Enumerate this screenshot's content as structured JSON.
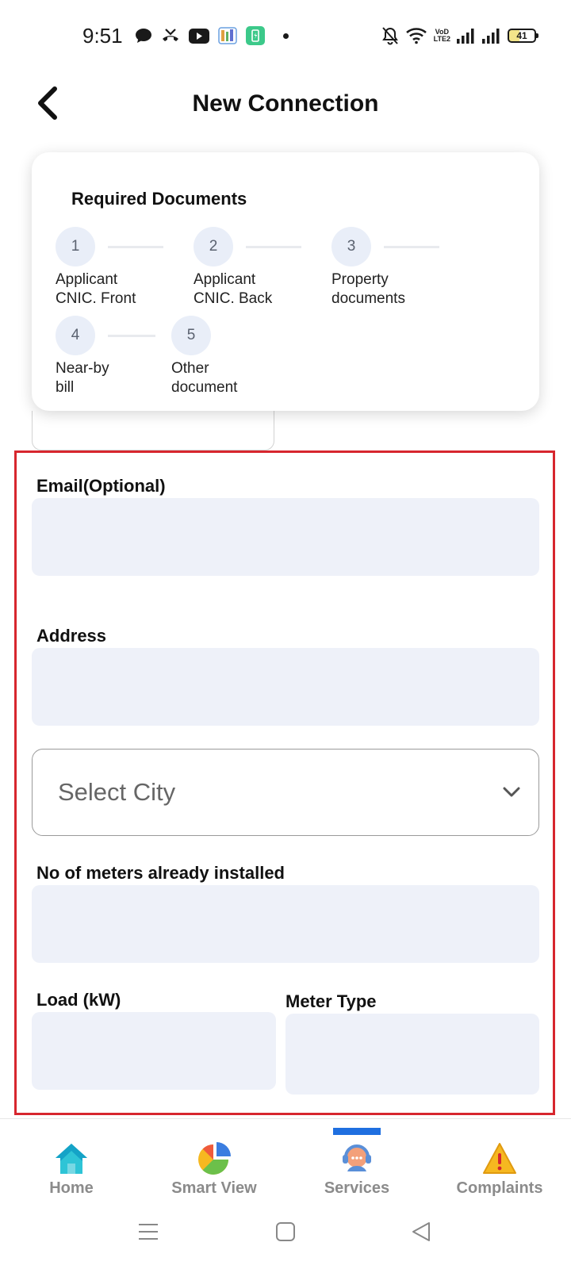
{
  "status_bar": {
    "time": "9:51",
    "battery": "41",
    "icons_left": [
      "chat-bubble-icon",
      "missed-call-icon",
      "youtube-icon",
      "app-icon",
      "battery-saver-icon",
      "dot-icon"
    ],
    "icons_right": [
      "bell-off-icon",
      "wifi-icon",
      "volte-icon",
      "signal-icon",
      "signal-icon",
      "battery-icon"
    ],
    "volte_text": "VoD\nLTE2"
  },
  "header": {
    "title": "New Connection"
  },
  "documents": {
    "title": "Required Documents",
    "steps": [
      {
        "number": "1",
        "label_line1": "Applicant",
        "label_line2": "CNIC. Front"
      },
      {
        "number": "2",
        "label_line1": "Applicant",
        "label_line2": "CNIC. Back"
      },
      {
        "number": "3",
        "label_line1": "Property",
        "label_line2": "documents"
      },
      {
        "number": "4",
        "label_line1": "Near-by",
        "label_line2": "bill"
      },
      {
        "number": "5",
        "label_line1": "Other",
        "label_line2": "document"
      }
    ]
  },
  "form": {
    "email_label": "Email(Optional)",
    "email_value": "",
    "address_label": "Address",
    "address_value": "",
    "city_placeholder": "Select City",
    "meters_label": "No of meters already installed",
    "meters_value": "",
    "load_label": "Load (kW)",
    "load_value": "",
    "meter_type_label": "Meter Type",
    "meter_type_value": ""
  },
  "bottom_nav": {
    "items": [
      {
        "label": "Home",
        "icon": "home-icon"
      },
      {
        "label": "Smart View",
        "icon": "pie-chart-icon"
      },
      {
        "label": "Services",
        "icon": "support-agent-icon"
      },
      {
        "label": "Complaints",
        "icon": "warning-icon"
      }
    ],
    "active_index": 2
  },
  "colors": {
    "accent": "#1f6fe0",
    "highlight": "#d7262e",
    "input_bg": "#eef1f9",
    "nav_label": "#8b8b8b"
  }
}
